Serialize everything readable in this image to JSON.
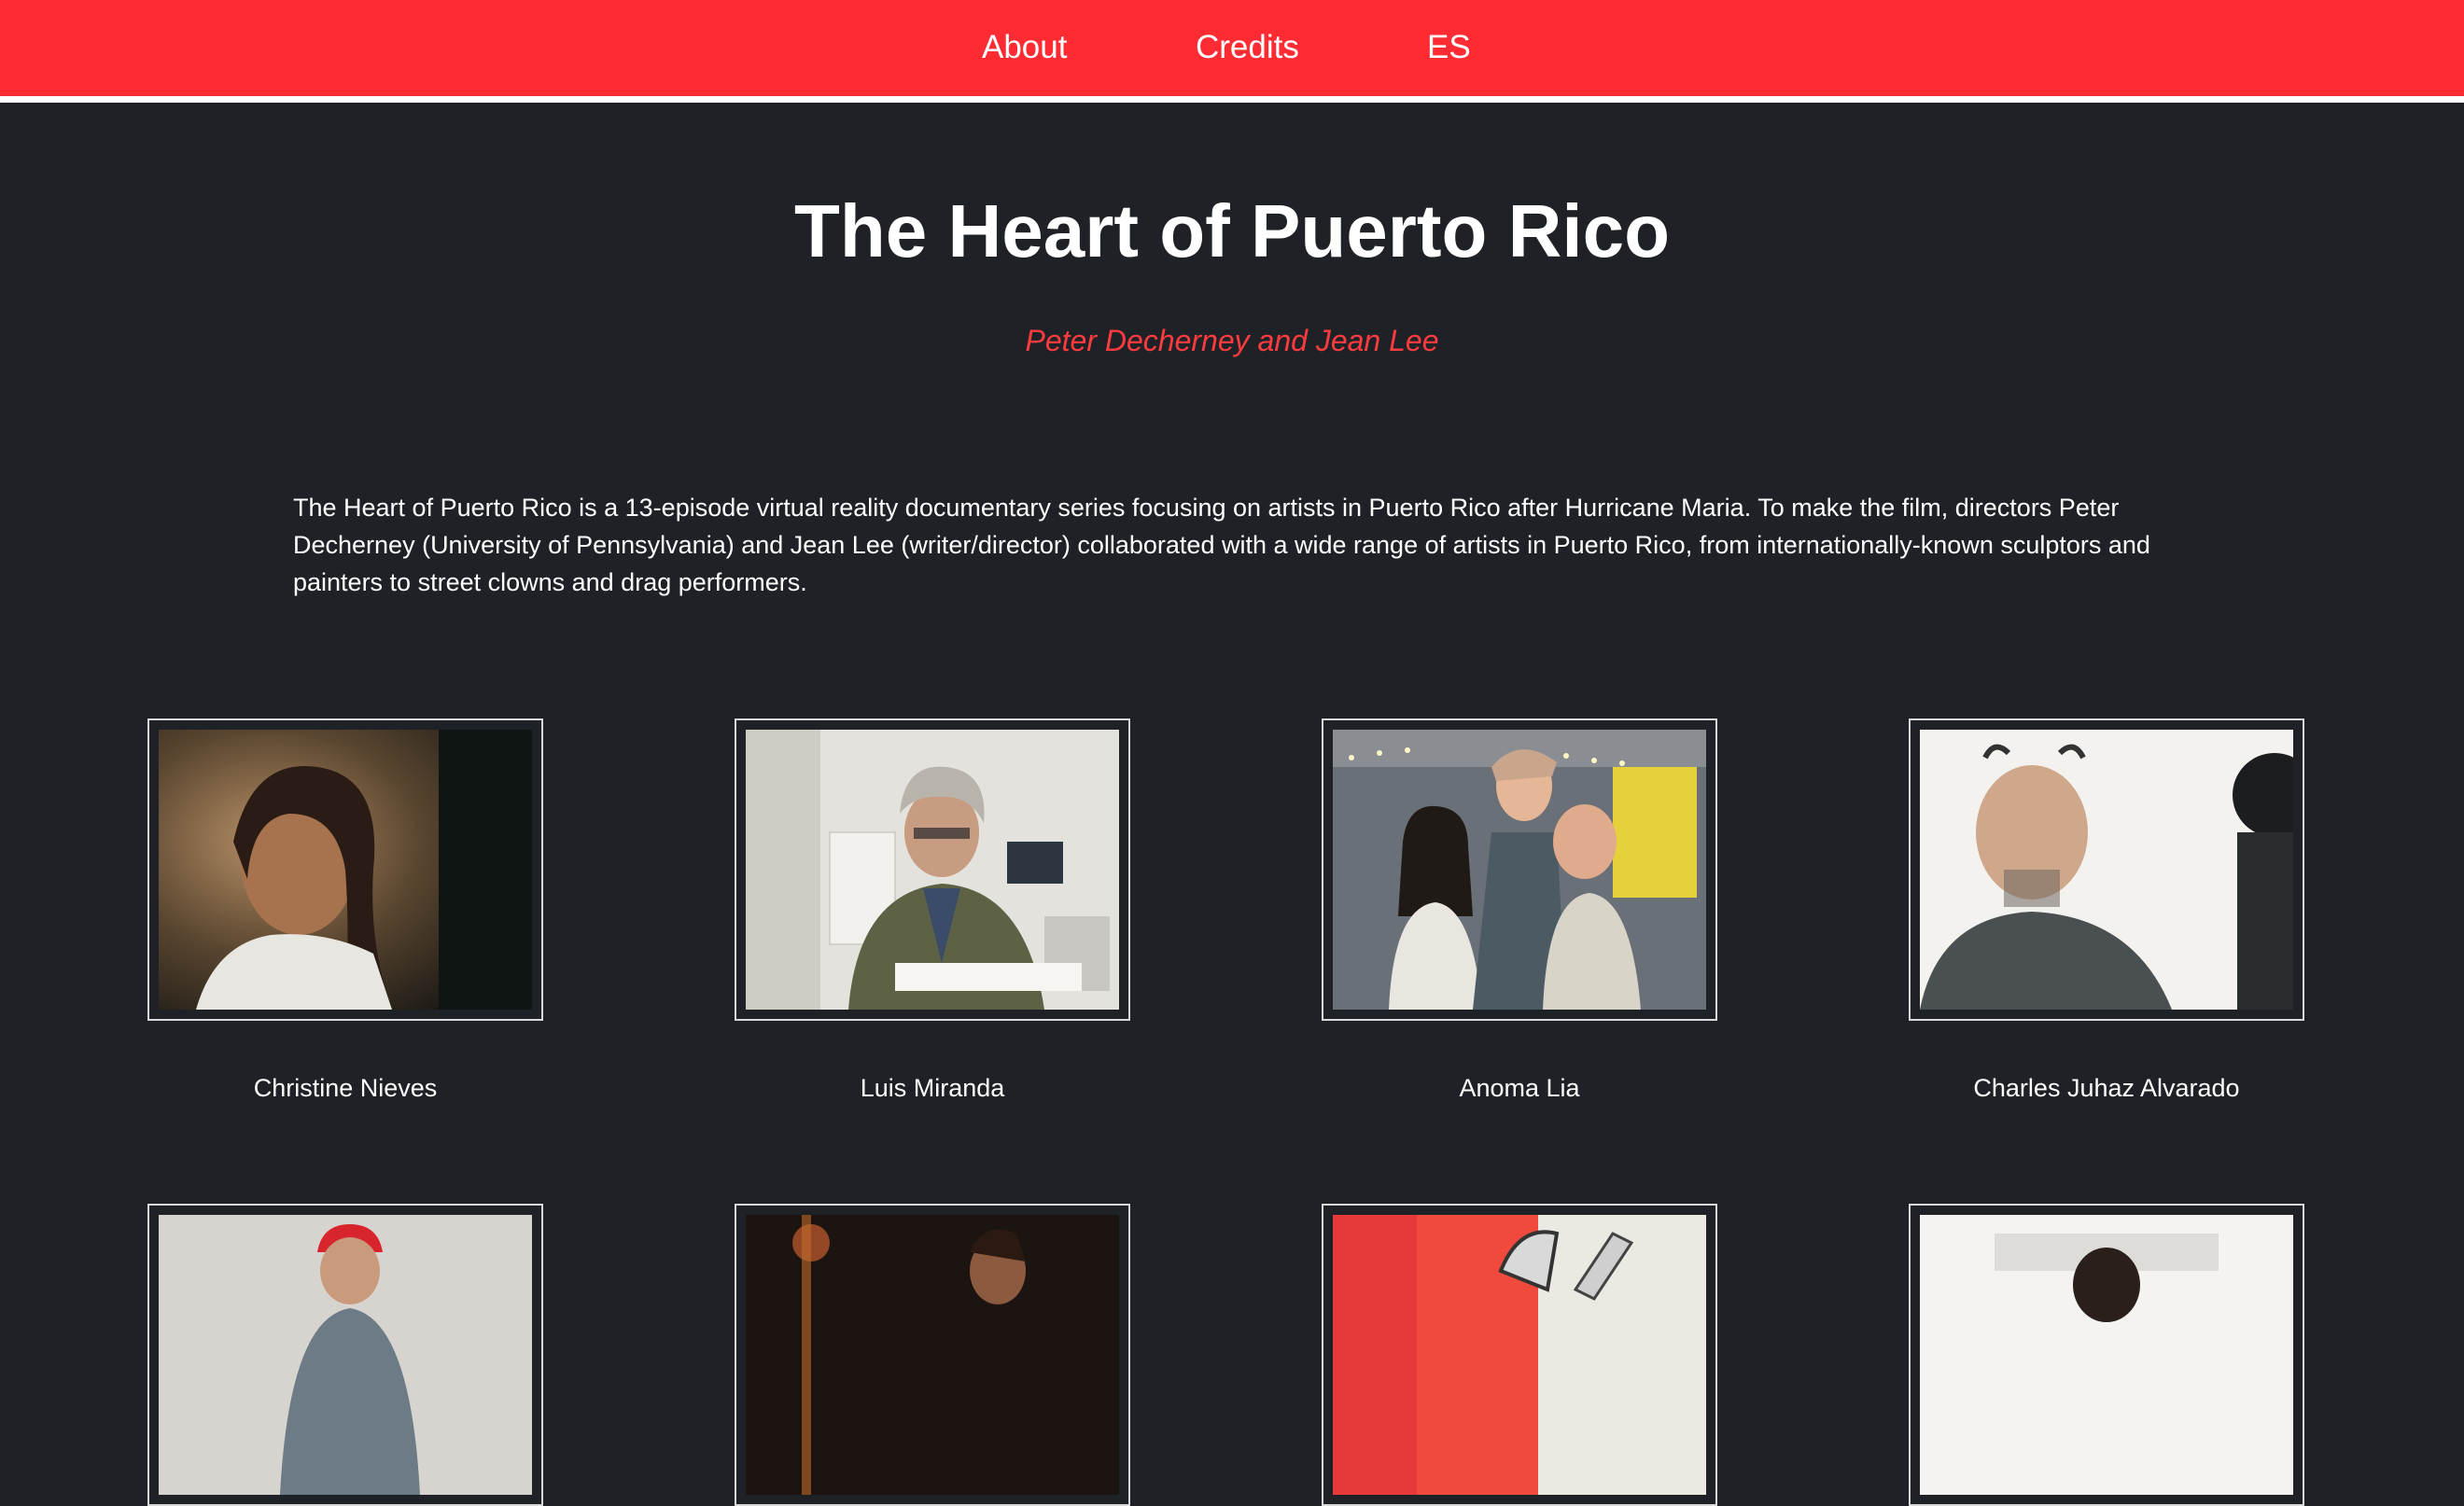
{
  "nav": {
    "about": "About",
    "credits": "Credits",
    "language": "ES"
  },
  "header": {
    "title": "The Heart of Puerto Rico",
    "authors": "Peter Decherney and Jean Lee"
  },
  "intro": "The Heart of Puerto Rico is a 13-episode virtual reality documentary series focusing on artists in Puerto Rico after Hurricane Maria. To make the film, directors Peter Decherney (University of Pennsylvania) and Jean Lee (writer/director) collaborated with a wide range of artists in Puerto Rico, from internationally-known sculptors and painters to street clowns and drag performers.",
  "artists": [
    {
      "name": "Christine Nieves"
    },
    {
      "name": "Luis Miranda"
    },
    {
      "name": "Anoma Lia"
    },
    {
      "name": "Charles Juhaz Alvarado"
    }
  ],
  "colors": {
    "nav_background": "#ff2b32",
    "page_background": "#1e2226",
    "accent": "#ff3b3f",
    "text": "#ffffff"
  }
}
